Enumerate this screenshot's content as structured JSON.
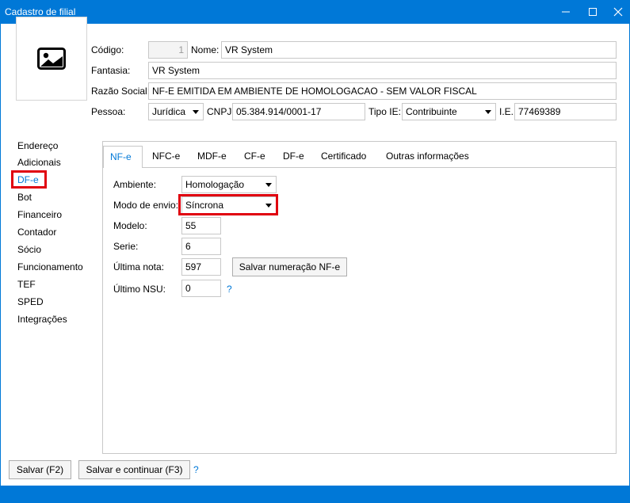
{
  "window": {
    "title": "Cadastro de filial"
  },
  "header": {
    "codigo_label": "Código:",
    "codigo_value": "1",
    "nome_label": "Nome:",
    "nome_value": "VR System",
    "fantasia_label": "Fantasia:",
    "fantasia_value": "VR System",
    "razao_label": "Razão Social:",
    "razao_value": "NF-E EMITIDA EM AMBIENTE DE HOMOLOGACAO - SEM VALOR FISCAL",
    "pessoa_label": "Pessoa:",
    "pessoa_value": "Jurídica",
    "cnpj_label": "CNPJ:",
    "cnpj_value": "05.384.914/0001-17",
    "tipoie_label": "Tipo IE:",
    "tipoie_value": "Contribuinte",
    "ie_label": "I.E.:",
    "ie_value": "77469389"
  },
  "sidebar": {
    "items": [
      {
        "label": "Endereço"
      },
      {
        "label": "Adicionais"
      },
      {
        "label": "DF-e"
      },
      {
        "label": "Bot"
      },
      {
        "label": "Financeiro"
      },
      {
        "label": "Contador"
      },
      {
        "label": "Sócio"
      },
      {
        "label": "Funcionamento"
      },
      {
        "label": "TEF"
      },
      {
        "label": "SPED"
      },
      {
        "label": "Integrações"
      }
    ],
    "active": "DF-e"
  },
  "tabs": [
    {
      "label": "NF-e"
    },
    {
      "label": "NFC-e"
    },
    {
      "label": "MDF-e"
    },
    {
      "label": "CF-e"
    },
    {
      "label": "DF-e"
    },
    {
      "label": "Certificado"
    },
    {
      "label": "Outras informações"
    }
  ],
  "nfe": {
    "ambiente_label": "Ambiente:",
    "ambiente_value": "Homologação",
    "modo_label": "Modo de envio:",
    "modo_value": "Síncrona",
    "modelo_label": "Modelo:",
    "modelo_value": "55",
    "serie_label": "Serie:",
    "serie_value": "6",
    "ultima_label": "Última nota:",
    "ultima_value": "597",
    "salvar_numeracao_label": "Salvar numeração NF-e",
    "nsu_label": "Último NSU:",
    "nsu_value": "0",
    "help": "?"
  },
  "footer": {
    "salvar_label": "Salvar (F2)",
    "salvar_continuar_label": "Salvar e continuar (F3)",
    "help": "?"
  },
  "icons": {
    "minimize": "minimize-icon",
    "maximize": "maximize-icon",
    "close": "close-icon",
    "photo": "image-icon"
  },
  "colors": {
    "accent": "#0078d7",
    "highlight": "#e0000f"
  }
}
